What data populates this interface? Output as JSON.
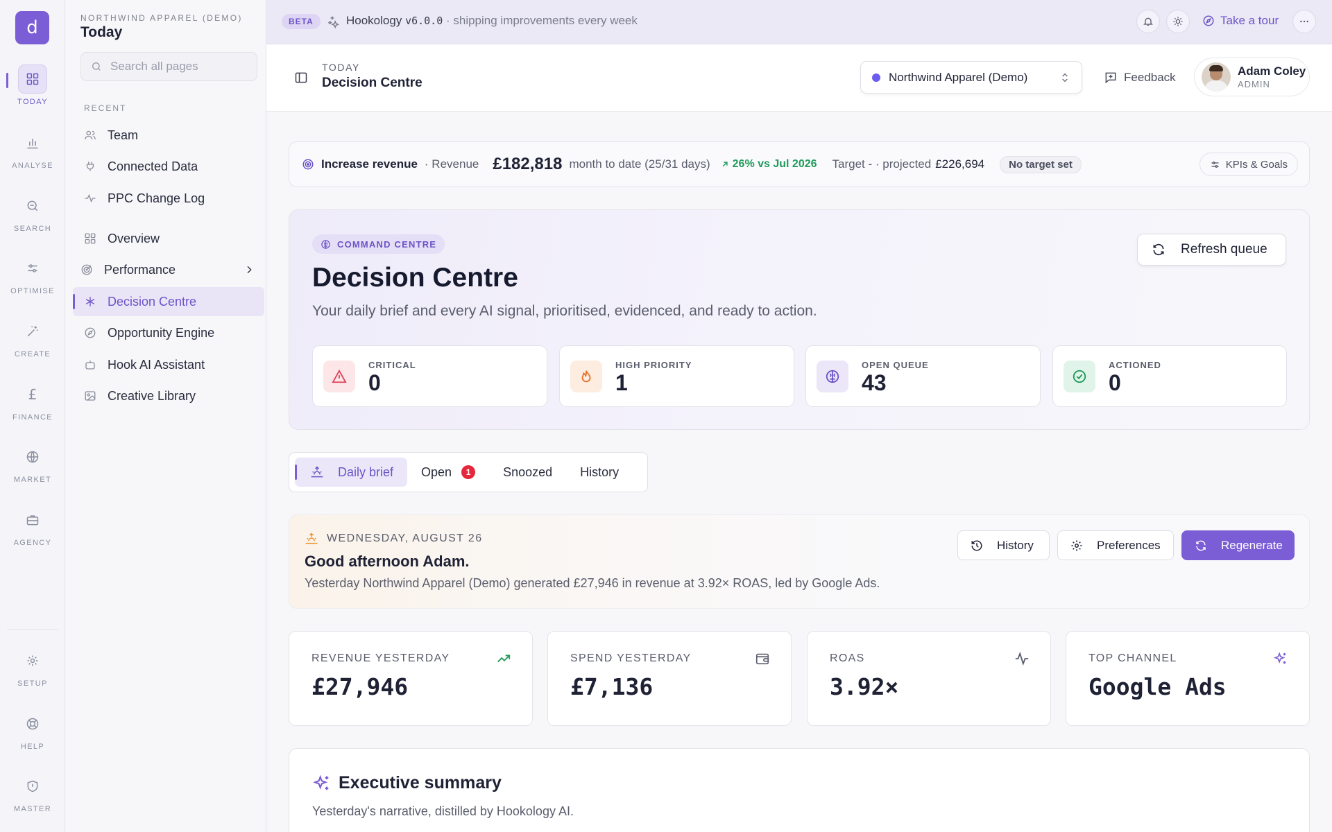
{
  "app": {
    "logo_glyph": "d",
    "accent": "#7b5dd6"
  },
  "rail": [
    {
      "label": "TODAY",
      "icon": "grid-icon"
    },
    {
      "label": "ANALYSE",
      "icon": "bar-chart-icon"
    },
    {
      "label": "SEARCH",
      "icon": "search-icon"
    },
    {
      "label": "OPTIMISE",
      "icon": "sliders-icon"
    },
    {
      "label": "CREATE",
      "icon": "wand-icon"
    },
    {
      "label": "FINANCE",
      "icon": "pound-icon"
    },
    {
      "label": "MARKET",
      "icon": "globe-icon"
    },
    {
      "label": "AGENCY",
      "icon": "briefcase-icon"
    },
    {
      "label": "SETUP",
      "icon": "gear-icon"
    },
    {
      "label": "HELP",
      "icon": "lifebuoy-icon"
    },
    {
      "label": "MASTER",
      "icon": "shield-icon"
    }
  ],
  "sidebar": {
    "workspace": "NORTHWIND APPAREL (DEMO)",
    "title": "Today",
    "search_placeholder": "Search all pages",
    "recent_label": "RECENT",
    "recent": [
      {
        "label": "Team",
        "icon": "users-icon"
      },
      {
        "label": "Connected Data",
        "icon": "plug-icon"
      },
      {
        "label": "PPC Change Log",
        "icon": "activity-icon"
      }
    ],
    "items": [
      {
        "label": "Overview",
        "icon": "grid-icon"
      },
      {
        "label": "Performance",
        "icon": "target-icon"
      },
      {
        "label": "Decision Centre",
        "icon": "asterisk-icon"
      },
      {
        "label": "Opportunity Engine",
        "icon": "compass-icon"
      },
      {
        "label": "Hook AI Assistant",
        "icon": "bot-icon"
      },
      {
        "label": "Creative Library",
        "icon": "image-icon"
      }
    ]
  },
  "banner": {
    "beta": "BETA",
    "product": "Hookology",
    "version": "v6.0.0",
    "tagline": "· shipping improvements every week",
    "tour": "Take a tour"
  },
  "header": {
    "section": "TODAY",
    "title": "Decision Centre",
    "account": "Northwind Apparel (Demo)",
    "account_dot_color": "#6b5cf0",
    "feedback": "Feedback",
    "user_name": "Adam Coley",
    "user_role": "ADMIN"
  },
  "kpi": {
    "goal": "Increase revenue",
    "metric": "· Revenue",
    "amount": "£182,818",
    "period": "month to date (25/31 days)",
    "delta": "26% vs Jul 2026",
    "target": "Target - · projected",
    "projected": "£226,694",
    "no_target": "No target set",
    "button": "KPIs & Goals"
  },
  "hero": {
    "badge": "COMMAND CENTRE",
    "title": "Decision Centre",
    "subtitle": "Your daily brief and every AI signal, prioritised, evidenced, and ready to action.",
    "refresh": "Refresh queue",
    "stats": [
      {
        "label": "CRITICAL",
        "value": "0",
        "icon": "alert-triangle-icon",
        "color": "#e0435a",
        "bg": "#fde6e8"
      },
      {
        "label": "HIGH PRIORITY",
        "value": "1",
        "icon": "flame-icon",
        "color": "#e8702a",
        "bg": "#fdece0"
      },
      {
        "label": "OPEN QUEUE",
        "value": "43",
        "icon": "brain-icon",
        "color": "#6b54c7",
        "bg": "#ebe6f8"
      },
      {
        "label": "ACTIONED",
        "value": "0",
        "icon": "check-circle-icon",
        "color": "#1e9a5a",
        "bg": "#e0f4ea"
      }
    ]
  },
  "tabs": [
    {
      "label": "Daily brief"
    },
    {
      "label": "Open",
      "badge": "1"
    },
    {
      "label": "Snoozed"
    },
    {
      "label": "History"
    }
  ],
  "brief": {
    "date": "WEDNESDAY, AUGUST 26",
    "greeting": "Good afternoon Adam.",
    "summary": "Yesterday Northwind Apparel (Demo) generated £27,946 in revenue at 3.92× ROAS, led by Google Ads.",
    "history": "History",
    "preferences": "Preferences",
    "regenerate": "Regenerate"
  },
  "metrics": [
    {
      "label": "REVENUE YESTERDAY",
      "value": "£27,946",
      "icon": "trending-up-icon"
    },
    {
      "label": "SPEND YESTERDAY",
      "value": "£7,136",
      "icon": "wallet-icon"
    },
    {
      "label": "ROAS",
      "value": "3.92×",
      "icon": "pulse-icon"
    },
    {
      "label": "TOP CHANNEL",
      "value": "Google Ads",
      "icon": "sparkles-icon"
    }
  ],
  "exec": {
    "title": "Executive summary",
    "subtitle": "Yesterday's narrative, distilled by Hookology AI."
  }
}
